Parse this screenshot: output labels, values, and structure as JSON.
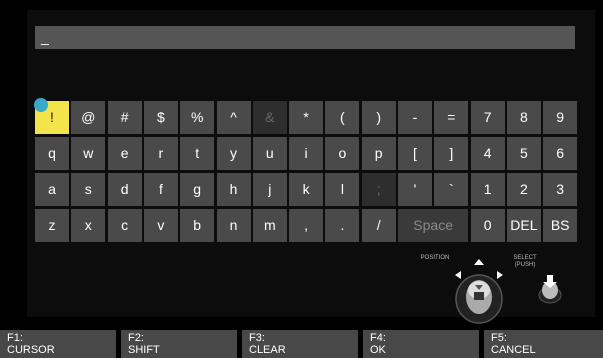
{
  "input": {
    "value": "_"
  },
  "keyboard": {
    "rows": [
      [
        {
          "label": "!",
          "state": "selected"
        },
        {
          "label": "@"
        },
        {
          "label": "#"
        },
        {
          "label": "$"
        },
        {
          "label": "%"
        },
        {
          "label": "^"
        },
        {
          "label": "&",
          "state": "disabled"
        },
        {
          "label": "*"
        },
        {
          "label": "("
        },
        {
          "label": ")"
        },
        {
          "label": "-"
        },
        {
          "label": "="
        },
        {
          "label": "7"
        },
        {
          "label": "8"
        },
        {
          "label": "9"
        }
      ],
      [
        {
          "label": "q"
        },
        {
          "label": "w"
        },
        {
          "label": "e"
        },
        {
          "label": "r"
        },
        {
          "label": "t"
        },
        {
          "label": "y"
        },
        {
          "label": "u"
        },
        {
          "label": "i"
        },
        {
          "label": "o"
        },
        {
          "label": "p"
        },
        {
          "label": "["
        },
        {
          "label": "]"
        },
        {
          "label": "4"
        },
        {
          "label": "5"
        },
        {
          "label": "6"
        }
      ],
      [
        {
          "label": "a"
        },
        {
          "label": "s"
        },
        {
          "label": "d"
        },
        {
          "label": "f"
        },
        {
          "label": "g"
        },
        {
          "label": "h"
        },
        {
          "label": "j"
        },
        {
          "label": "k"
        },
        {
          "label": "l"
        },
        {
          "label": ";",
          "state": "disabled"
        },
        {
          "label": "'"
        },
        {
          "label": "`"
        },
        {
          "label": "1"
        },
        {
          "label": "2"
        },
        {
          "label": "3"
        }
      ],
      [
        {
          "label": "z"
        },
        {
          "label": "x"
        },
        {
          "label": "c"
        },
        {
          "label": "v"
        },
        {
          "label": "b"
        },
        {
          "label": "n"
        },
        {
          "label": "m"
        },
        {
          "label": ","
        },
        {
          "label": "."
        },
        {
          "label": "/"
        },
        {
          "label": "Space",
          "state": "disabled",
          "span": 2
        },
        {
          "label": "0"
        },
        {
          "label": "DEL"
        },
        {
          "label": "BS"
        }
      ]
    ]
  },
  "controls": {
    "position_label": "POSITION",
    "select_label_1": "SELECT",
    "select_label_2": "(PUSH)"
  },
  "function_keys": [
    {
      "key": "F1:",
      "action": "CURSOR"
    },
    {
      "key": "F2:",
      "action": "SHIFT"
    },
    {
      "key": "F3:",
      "action": "CLEAR"
    },
    {
      "key": "F4:",
      "action": "OK"
    },
    {
      "key": "F5:",
      "action": "CANCEL"
    }
  ],
  "colors": {
    "selected_key": "#f4e44c",
    "cursor_dot": "#3aa8c8",
    "key_bg": "#4a4a4a"
  }
}
